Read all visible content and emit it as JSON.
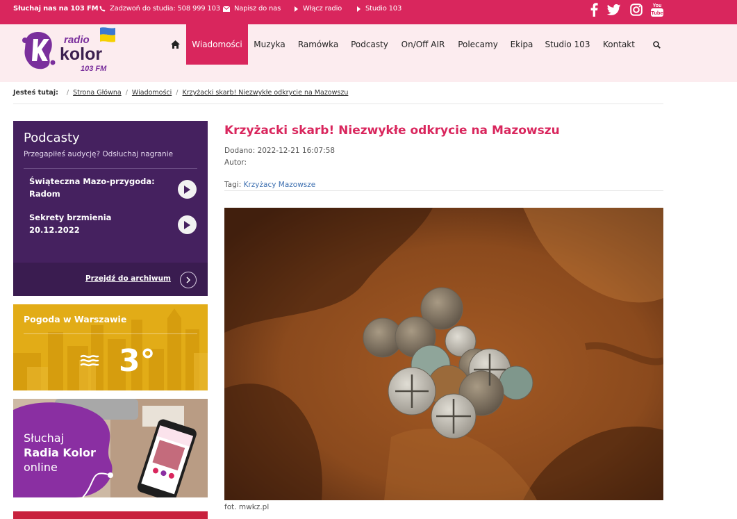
{
  "topbar": {
    "listen": "Słuchaj nas na 103 FM",
    "call": "Zadzwoń do studia: 508 999 103",
    "write": "Napisz do nas",
    "radio_on": "Włącz radio",
    "studio": "Studio 103",
    "social": [
      "facebook-icon",
      "twitter-icon",
      "instagram-icon",
      "youtube-icon"
    ]
  },
  "logo": {
    "line1": "radio",
    "line2": "kolor",
    "line3": "103 FM"
  },
  "nav": {
    "items": [
      "Wiadomości",
      "Muzyka",
      "Ramówka",
      "Podcasty",
      "On/Off AIR",
      "Polecamy",
      "Ekipa",
      "Studio 103",
      "Kontakt"
    ],
    "active": "Wiadomości"
  },
  "breadcrumb": {
    "label": "Jesteś tutaj:",
    "items": [
      "Strona Główna",
      "Wiadomości",
      "Krzyżacki skarb! Niezwykłe odkrycie na Mazowszu"
    ]
  },
  "podcasts": {
    "title": "Podcasty",
    "subtitle": "Przegapiłeś audycję? Odsłuchaj nagranie",
    "items": [
      {
        "line1": "Świąteczna Mazo-przygoda:",
        "line2": "Radom"
      },
      {
        "line1": "Sekrety brzmienia",
        "line2": "20.12.2022"
      }
    ],
    "archive": "Przejdź do archiwum"
  },
  "weather": {
    "title": "Pogoda w Warszawie",
    "temp": "3°"
  },
  "listen_banner": {
    "line1": "Słuchaj",
    "line2": "Radia Kolor",
    "line3": "online"
  },
  "article": {
    "title": "Krzyżacki skarb! Niezwykłe odkrycie na Mazowszu",
    "added": "Dodano: 2022-12-21 16:07:58",
    "author": "Autor:",
    "tags_label": "Tagi:",
    "tags": "Krzyżacy Mazowsze",
    "caption": "fot. mwkz.pl"
  },
  "colors": {
    "brand": "#d9265d",
    "purple": "#45215f",
    "weather": "#e2ac17"
  }
}
